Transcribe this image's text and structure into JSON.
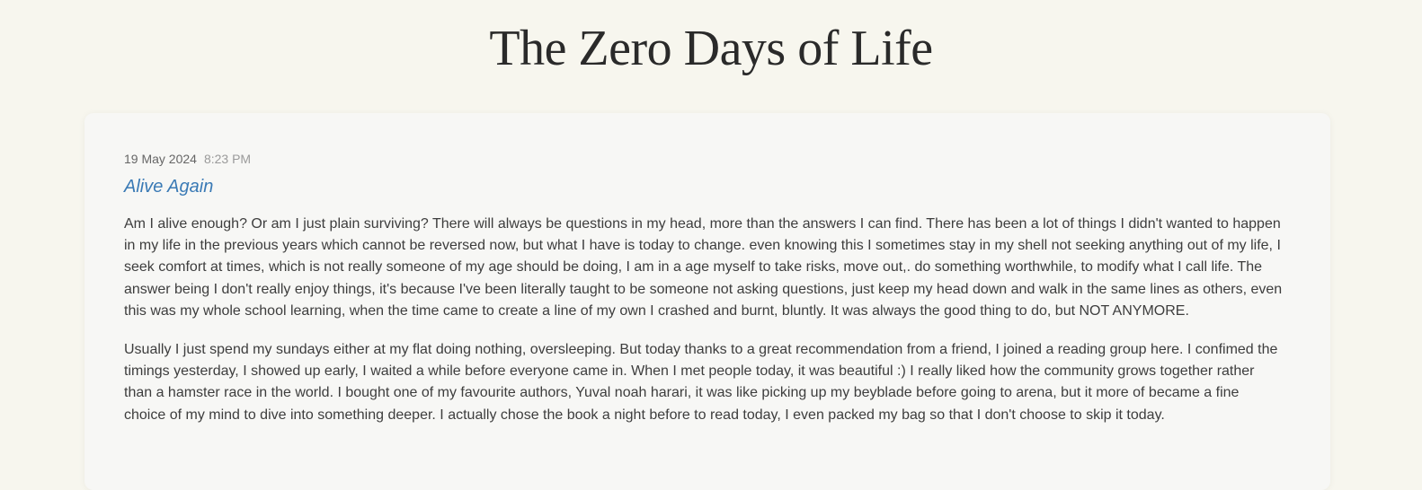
{
  "site": {
    "title": "The Zero Days of Life"
  },
  "entry": {
    "date": "19 May 2024",
    "time": "8:23 PM",
    "title": "Alive Again",
    "paragraphs": [
      "Am I alive enough? Or am I just plain surviving? There will always be questions in my head, more than the answers I can find. There has been a lot of things I didn't wanted to happen in my life in the previous years which cannot be reversed now, but what I have is today to change. even knowing this I sometimes stay in my shell not seeking anything out of my life, I seek comfort at times, which is not really someone of my age should be doing, I am in a age myself to take risks, move out,. do something worthwhile, to modify what I call life. The answer being I don't really enjoy things, it's because I've been literally taught to be someone not asking questions, just keep my head down and walk in the same lines as others, even this was my whole school learning, when the time came to create a line of my own I crashed and burnt, bluntly. It was always the good thing to do, but NOT ANYMORE.",
      "Usually I just spend my sundays either at my flat doing nothing, oversleeping. But today thanks to a great recommendation from a friend, I joined a reading group here. I confimed the timings yesterday, I showed up early, I waited a while before everyone came in. When I met people today, it was beautiful :) I really liked how the community grows together rather than a hamster race in the world. I bought one of my favourite authors, Yuval noah harari, it was like picking up my beyblade before going to arena, but it more of became a fine choice of my mind to dive into something deeper. I actually chose the book a night before to read today, I even packed my bag so that I don't choose to skip it today."
    ]
  }
}
